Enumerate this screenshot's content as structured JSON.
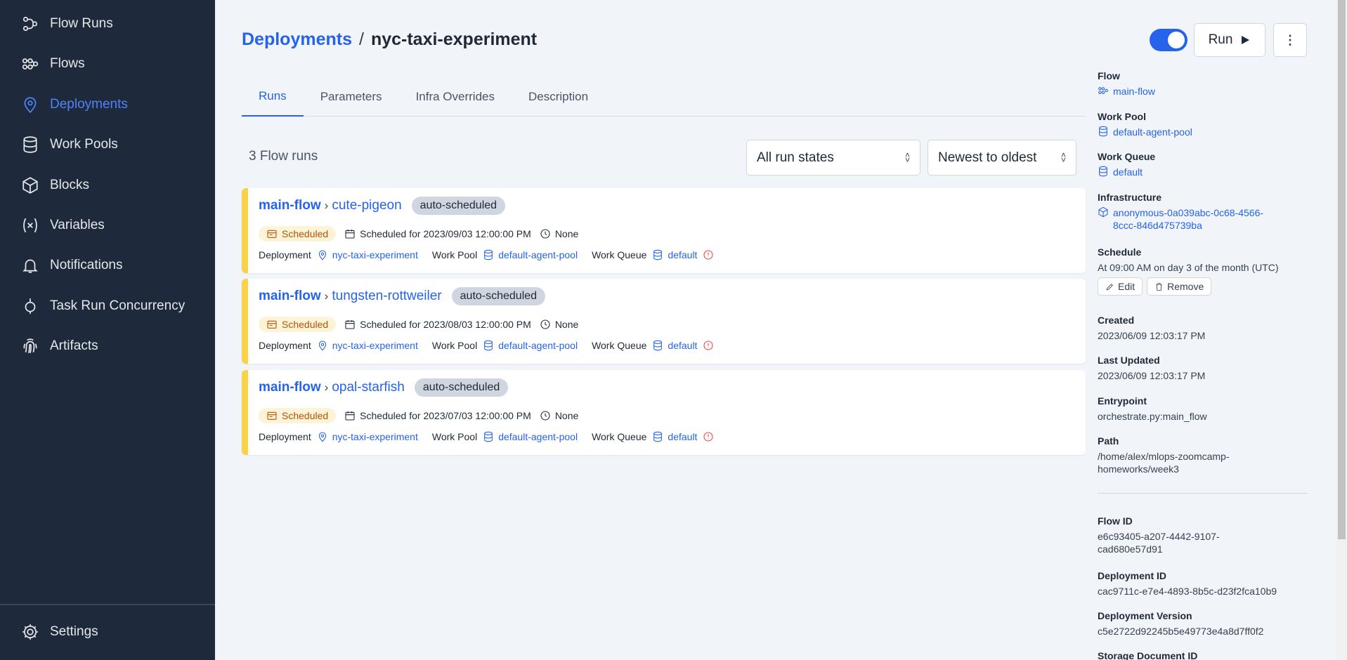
{
  "sidebar": {
    "items": [
      {
        "label": "Flow Runs",
        "icon": "flow-runs-icon"
      },
      {
        "label": "Flows",
        "icon": "flows-icon"
      },
      {
        "label": "Deployments",
        "icon": "map-pin-icon",
        "active": true
      },
      {
        "label": "Work Pools",
        "icon": "database-icon"
      },
      {
        "label": "Blocks",
        "icon": "cube-icon"
      },
      {
        "label": "Variables",
        "icon": "variable-icon"
      },
      {
        "label": "Notifications",
        "icon": "bell-icon"
      },
      {
        "label": "Task Run Concurrency",
        "icon": "concurrency-icon"
      },
      {
        "label": "Artifacts",
        "icon": "fingerprint-icon"
      }
    ],
    "settings": {
      "label": "Settings",
      "icon": "gear-icon"
    }
  },
  "header": {
    "breadcrumb_root": "Deployments",
    "breadcrumb_sep": "/",
    "breadcrumb_current": "nyc-taxi-experiment",
    "run_label": "Run",
    "more_label": "⋮",
    "toggle_on": true
  },
  "tabs": [
    {
      "label": "Runs",
      "active": true
    },
    {
      "label": "Parameters"
    },
    {
      "label": "Infra Overrides"
    },
    {
      "label": "Description"
    }
  ],
  "runs": {
    "count_label": "3 Flow runs",
    "state_filter": "All run states",
    "sort": "Newest to oldest",
    "items": [
      {
        "flow": "main-flow",
        "name": "cute-pigeon",
        "tag": "auto-scheduled",
        "state": "Scheduled",
        "scheduled": "Scheduled for 2023/09/03 12:00:00 PM",
        "duration": "None",
        "deployment_label": "Deployment",
        "deployment": "nyc-taxi-experiment",
        "work_pool_label": "Work Pool",
        "work_pool": "default-agent-pool",
        "work_queue_label": "Work Queue",
        "work_queue": "default"
      },
      {
        "flow": "main-flow",
        "name": "tungsten-rottweiler",
        "tag": "auto-scheduled",
        "state": "Scheduled",
        "scheduled": "Scheduled for 2023/08/03 12:00:00 PM",
        "duration": "None",
        "deployment_label": "Deployment",
        "deployment": "nyc-taxi-experiment",
        "work_pool_label": "Work Pool",
        "work_pool": "default-agent-pool",
        "work_queue_label": "Work Queue",
        "work_queue": "default"
      },
      {
        "flow": "main-flow",
        "name": "opal-starfish",
        "tag": "auto-scheduled",
        "state": "Scheduled",
        "scheduled": "Scheduled for 2023/07/03 12:00:00 PM",
        "duration": "None",
        "deployment_label": "Deployment",
        "deployment": "nyc-taxi-experiment",
        "work_pool_label": "Work Pool",
        "work_pool": "default-agent-pool",
        "work_queue_label": "Work Queue",
        "work_queue": "default"
      }
    ]
  },
  "details": {
    "flow_label": "Flow",
    "flow": "main-flow",
    "work_pool_label": "Work Pool",
    "work_pool": "default-agent-pool",
    "work_queue_label": "Work Queue",
    "work_queue": "default",
    "infrastructure_label": "Infrastructure",
    "infrastructure_1": "anonymous-0a039abc-0c68-4566-",
    "infrastructure_2": "8ccc-846d475739ba",
    "schedule_label": "Schedule",
    "schedule": "At 09:00 AM on day 3 of the month (UTC)",
    "edit_label": "Edit",
    "remove_label": "Remove",
    "created_label": "Created",
    "created": "2023/06/09 12:03:17 PM",
    "updated_label": "Last Updated",
    "updated": "2023/06/09 12:03:17 PM",
    "entrypoint_label": "Entrypoint",
    "entrypoint": "orchestrate.py:main_flow",
    "path_label": "Path",
    "path_1": "/home/alex/mlops-zoomcamp-",
    "path_2": "homeworks/week3",
    "flow_id_label": "Flow ID",
    "flow_id_1": "e6c93405-a207-4442-9107-",
    "flow_id_2": "cad680e57d91",
    "deployment_id_label": "Deployment ID",
    "deployment_id": "cac9711c-e7e4-4893-8b5c-d23f2fca10b9",
    "deployment_version_label": "Deployment Version",
    "deployment_version": "c5e2722d92245b5e49773e4a8d7ff0f2",
    "storage_label": "Storage Document ID"
  },
  "colors": {
    "sidebar_bg": "#1e2a3b",
    "accent": "#2563eb",
    "scheduled": "#f8d34a",
    "error": "#ef4444"
  }
}
